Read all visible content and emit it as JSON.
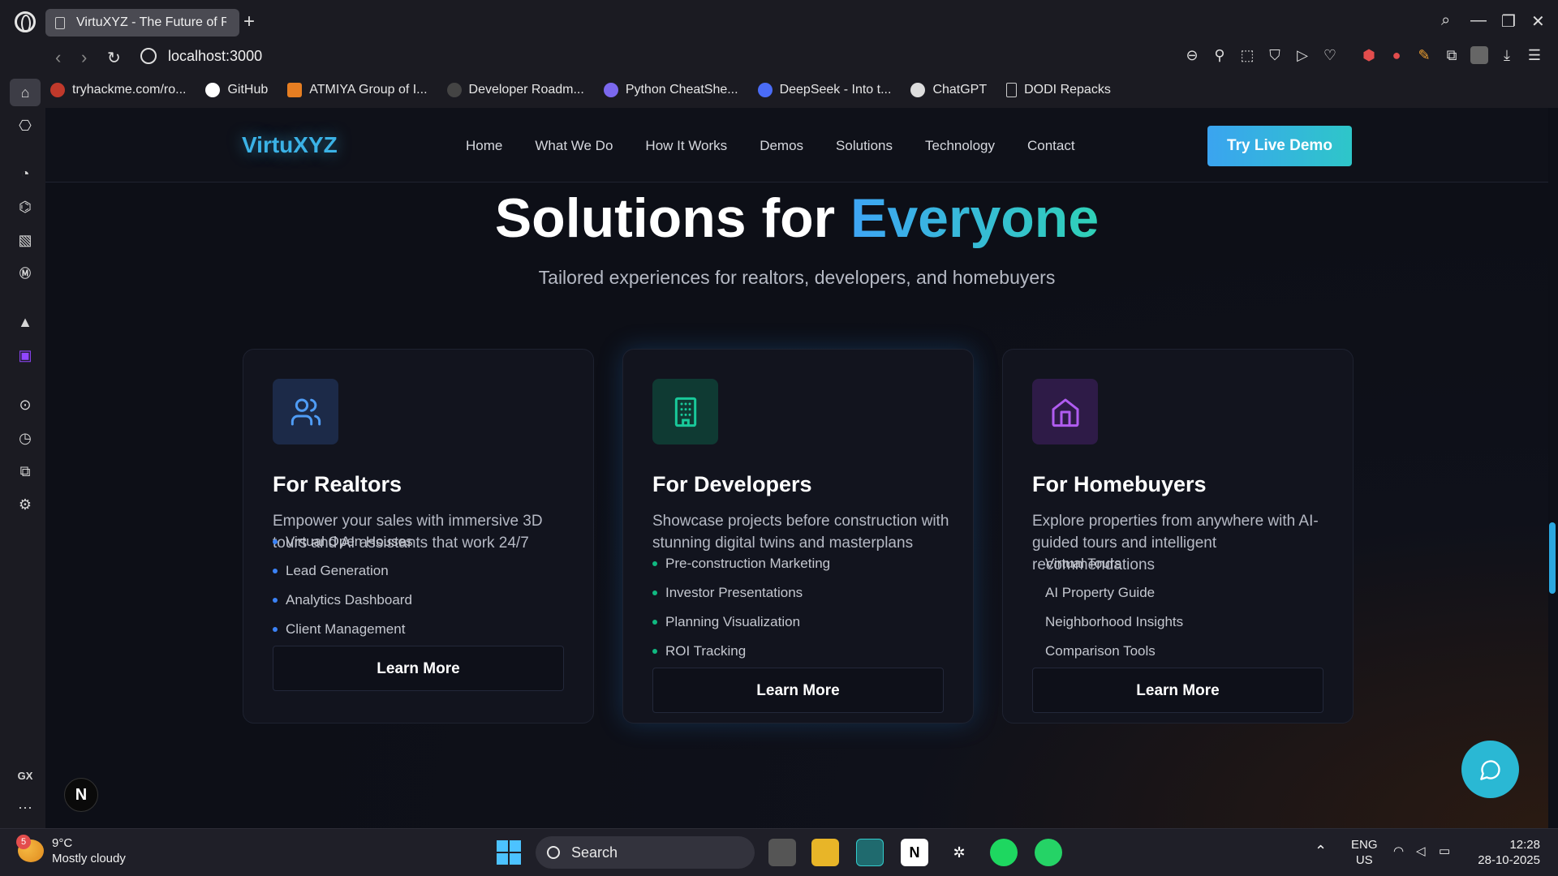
{
  "browser": {
    "tab_title": "VirtuXYZ - The Future of R",
    "url": "localhost:3000",
    "bookmarks": [
      {
        "label": "tryhackme.com/ro...",
        "color": "#c0392b"
      },
      {
        "label": "GitHub",
        "color": "#ffffff"
      },
      {
        "label": "ATMIYA Group of I...",
        "color": "#e67e22"
      },
      {
        "label": "Developer Roadm...",
        "color": "#333333"
      },
      {
        "label": "Python CheatShe...",
        "color": "#7b68ee"
      },
      {
        "label": "DeepSeek - Into t...",
        "color": "#4a6cf7"
      },
      {
        "label": "ChatGPT",
        "color": "#dddddd"
      },
      {
        "label": "DODI Repacks",
        "color": "#777777"
      }
    ],
    "sidebar_gx_label": "GX"
  },
  "site": {
    "brand": "VirtuXYZ",
    "nav": [
      "Home",
      "What We Do",
      "How It Works",
      "Demos",
      "Solutions",
      "Technology",
      "Contact"
    ],
    "cta": "Try Live Demo"
  },
  "hero": {
    "title_main": "Solutions for ",
    "title_accent": "Everyone",
    "subtitle": "Tailored experiences for realtors, developers, and homebuyers"
  },
  "cards": [
    {
      "title": "For Realtors",
      "description": "Empower your sales with immersive 3D tours and AI assistants that work 24/7",
      "items": [
        "Virtual Open Houses",
        "Lead Generation",
        "Analytics Dashboard",
        "Client Management"
      ],
      "button": "Learn More",
      "icon": "users-icon",
      "accent": "#3b82f6"
    },
    {
      "title": "For Developers",
      "description": "Showcase projects before construction with stunning digital twins and masterplans",
      "items": [
        "Pre-construction Marketing",
        "Investor Presentations",
        "Planning Visualization",
        "ROI Tracking"
      ],
      "button": "Learn More",
      "icon": "building-icon",
      "accent": "#10b981"
    },
    {
      "title": "For Homebuyers",
      "description": "Explore properties from anywhere with AI-guided tours and intelligent recommendations",
      "items": [
        "Virtual Tours",
        "AI Property Guide",
        "Neighborhood Insights",
        "Comparison Tools"
      ],
      "button": "Learn More",
      "icon": "home-icon",
      "accent": "#a855f7"
    }
  ],
  "floating": {
    "badge_letter": "N"
  },
  "taskbar": {
    "temp": "9°C",
    "weather": "Mostly cloudy",
    "weather_badge": "5",
    "search": "Search",
    "lang1": "ENG",
    "lang2": "US",
    "time": "12:28",
    "date": "28-10-2025"
  }
}
